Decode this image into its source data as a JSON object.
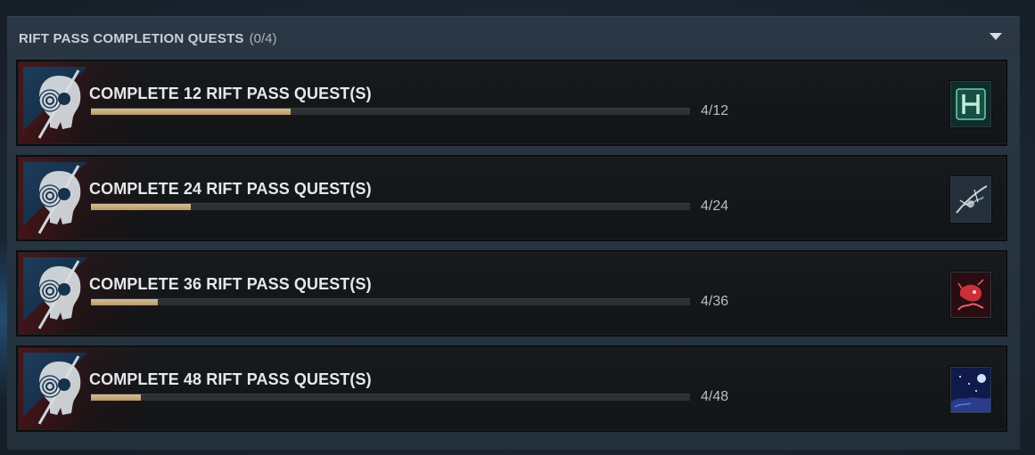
{
  "section": {
    "title": "RIFT PASS COMPLETION QUESTS",
    "count": "(0/4)"
  },
  "quests": [
    {
      "title": "COMPLETE 12 RIFT PASS QUEST(S)",
      "progress_text": "4/12",
      "progress": 0.333,
      "reward_icon": "letter-h-tile-icon",
      "reward_colors": [
        "#0f3a33",
        "#6fcfae"
      ]
    },
    {
      "title": "COMPLETE 24 RIFT PASS QUEST(S)",
      "progress_text": "4/24",
      "progress": 0.167,
      "reward_icon": "hand-sketch-icon",
      "reward_colors": [
        "#2a3a48",
        "#c9d3dc"
      ]
    },
    {
      "title": "COMPLETE 36 RIFT PASS QUEST(S)",
      "progress_text": "4/36",
      "progress": 0.111,
      "reward_icon": "red-creature-icon",
      "reward_colors": [
        "#2a0d10",
        "#c8303a"
      ]
    },
    {
      "title": "COMPLETE 48 RIFT PASS QUEST(S)",
      "progress_text": "4/48",
      "progress": 0.083,
      "reward_icon": "night-sky-icon",
      "reward_colors": [
        "#101a4a",
        "#5a78d8"
      ]
    }
  ]
}
